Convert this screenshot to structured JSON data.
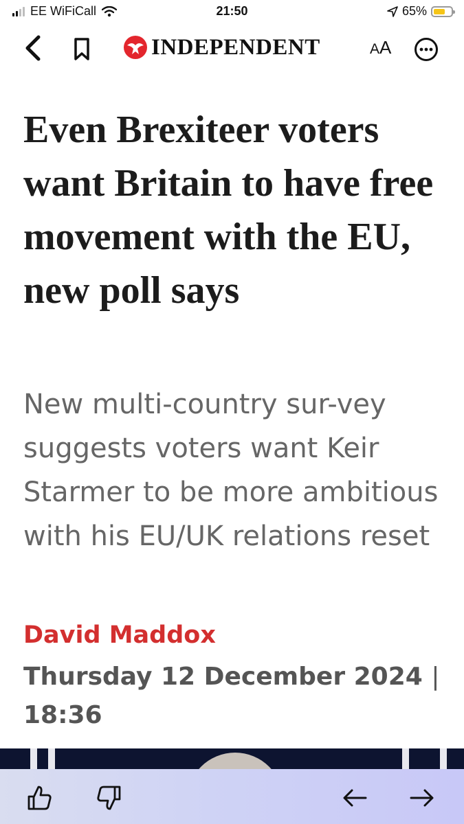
{
  "status_bar": {
    "carrier": "EE WiFiCall",
    "time": "21:50",
    "battery_percent": "65%",
    "battery_level": 0.65,
    "battery_color": "#f5c518"
  },
  "nav": {
    "back_icon": "chevron-left-icon",
    "bookmark_icon": "bookmark-icon",
    "brand": "INDEPENDENT",
    "brand_color": "#e3262d",
    "text_size_large": "A",
    "text_size_small": "A",
    "more_icon": "ellipsis-circle-icon"
  },
  "article": {
    "headline": "Even Brexiteer voters want Britain to have free movement with the EU, new poll says",
    "standfirst": "New multi-country sur-vey suggests voters want Keir Starmer to be more ambitious with his EU/UK relations reset",
    "author": "David Maddox",
    "date": "Thursday 12 December 2024",
    "separator": "|",
    "time": "18:36",
    "author_color": "#d32f2f"
  },
  "toolbar": {
    "like_icon": "thumbs-up-icon",
    "dislike_icon": "thumbs-down-icon",
    "back_icon": "arrow-left-icon",
    "forward_icon": "arrow-right-icon"
  }
}
